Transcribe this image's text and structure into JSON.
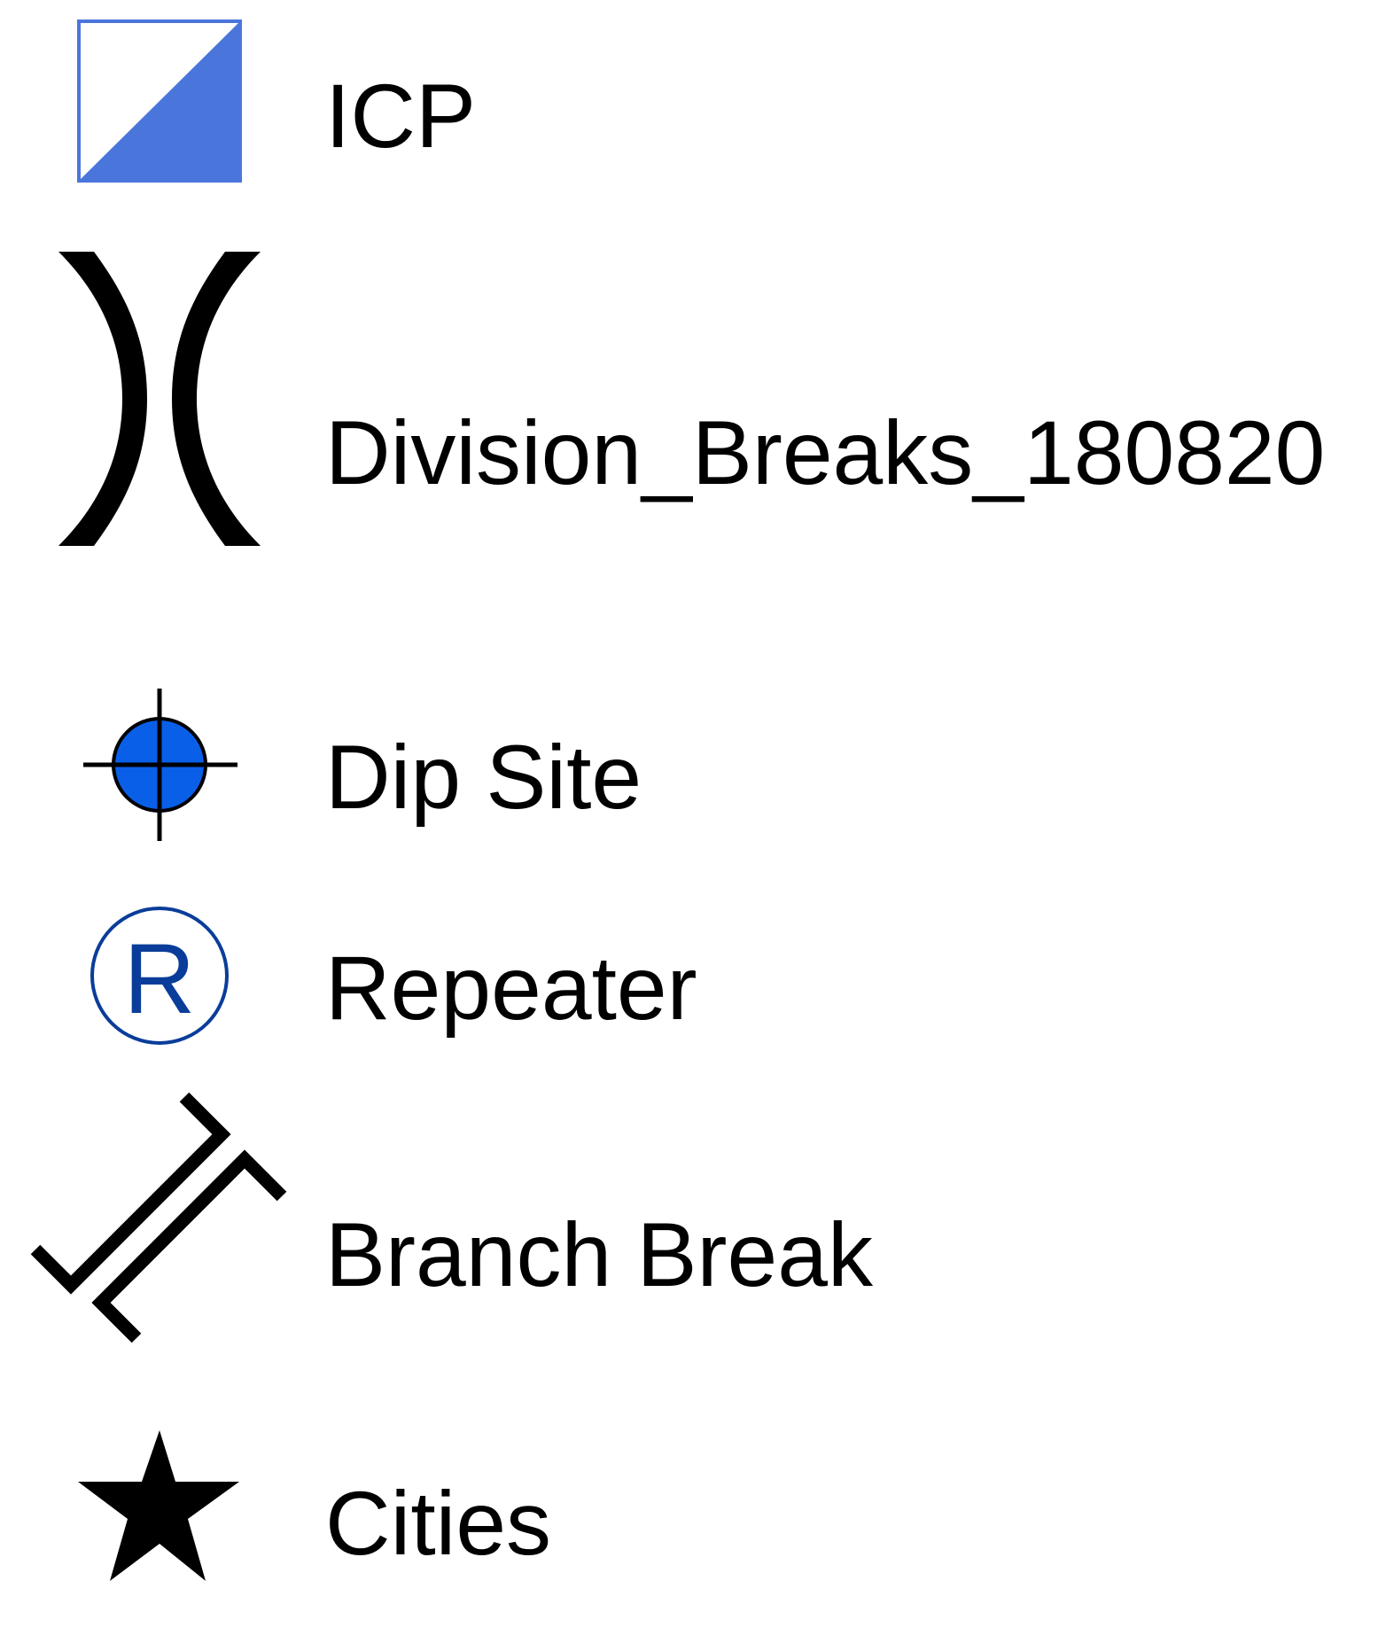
{
  "legend": {
    "items": [
      {
        "label": "ICP",
        "icon": "half-filled-square-icon",
        "fill_color": "#4a76dc",
        "stroke_color": "#4a76dc"
      },
      {
        "label": "Division_Breaks_180820",
        "icon": "double-arc-break-icon",
        "stroke_color": "#000000"
      },
      {
        "label": "Dip Site",
        "icon": "crosshair-circle-icon",
        "fill_color": "#0a5fe8",
        "stroke_color": "#000000"
      },
      {
        "label": "Repeater",
        "icon": "circled-r-icon",
        "letter": "R",
        "stroke_color": "#0a3d9a"
      },
      {
        "label": "Branch Break",
        "icon": "branch-break-icon",
        "stroke_color": "#000000"
      },
      {
        "label": "Cities",
        "icon": "star-icon",
        "fill_color": "#000000"
      }
    ]
  }
}
